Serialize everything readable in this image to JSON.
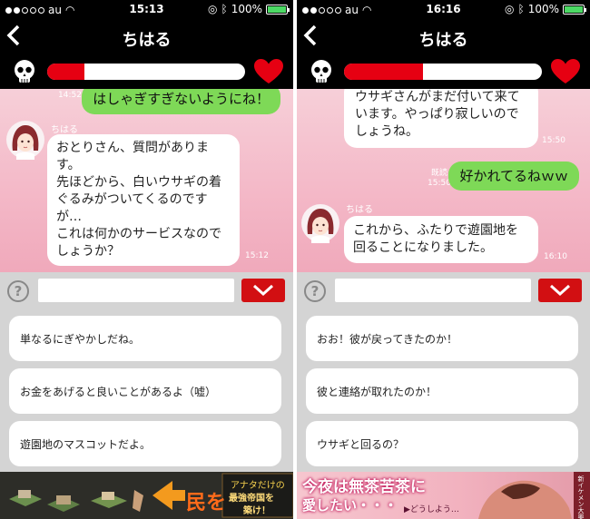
{
  "colors": {
    "accent_red": "#e60012",
    "my_bubble": "#7ed957",
    "chat_bg": "#f4b9c8",
    "battery": "#4cd964"
  },
  "icons": {
    "back": "chevron-left",
    "danger": "skull",
    "affection": "heart",
    "help": "question-mark",
    "dropdown": "chevron-down"
  },
  "screens": [
    {
      "status": {
        "carrier": "au",
        "time": "15:13",
        "battery": "100%"
      },
      "header": {
        "title": "ちはる",
        "back": "<"
      },
      "meter_level": 0.19,
      "chat": {
        "m1": {
          "text": "はしゃぎすぎないようにね！",
          "stamp": "14:52"
        },
        "m2": {
          "sender": "ちはる",
          "text": "おとりさん、質問があります。\n先ほどから、白いウサギの着ぐるみがついてくるのですが…\nこれは何かのサービスなのでしょうか？",
          "stamp": "15:12"
        }
      },
      "input": {
        "help": "?",
        "value": ""
      },
      "choices": [
        "単なるにぎやかしだね。",
        "お金をあげると良いことがあるよ（嘘）",
        "遊園地のマスコットだよ。"
      ],
      "ad": {
        "line1": "民を",
        "line2": "アナタだけの",
        "line3": "最強帝国を",
        "line4": "築け！"
      }
    },
    {
      "status": {
        "carrier": "au",
        "time": "16:16",
        "battery": "100%"
      },
      "header": {
        "title": "ちはる",
        "back": "<"
      },
      "meter_level": 0.4,
      "chat": {
        "m1": {
          "text": "ウサギさんがまだ付いて来ています。やっぱり寂しいのでしょうね。",
          "stamp": "15:50"
        },
        "m2": {
          "read": "既読",
          "text": "好かれてるねｗｗ",
          "stamp": "15:50"
        },
        "m3": {
          "sender": "ちはる",
          "text": "これから、ふたりで遊園地を回ることになりました。",
          "stamp": "16:10"
        }
      },
      "input": {
        "help": "?",
        "value": ""
      },
      "choices": [
        "おお！彼が戻ってきたのか！",
        "彼と連絡が取れたのか！",
        "ウサギと回るの？"
      ],
      "ad": {
        "line1": "今夜は無茶苦茶に",
        "line2": "愛したい・・・",
        "line3": "▶どうしよう…",
        "line4": "新イケメン大奥"
      }
    }
  ]
}
